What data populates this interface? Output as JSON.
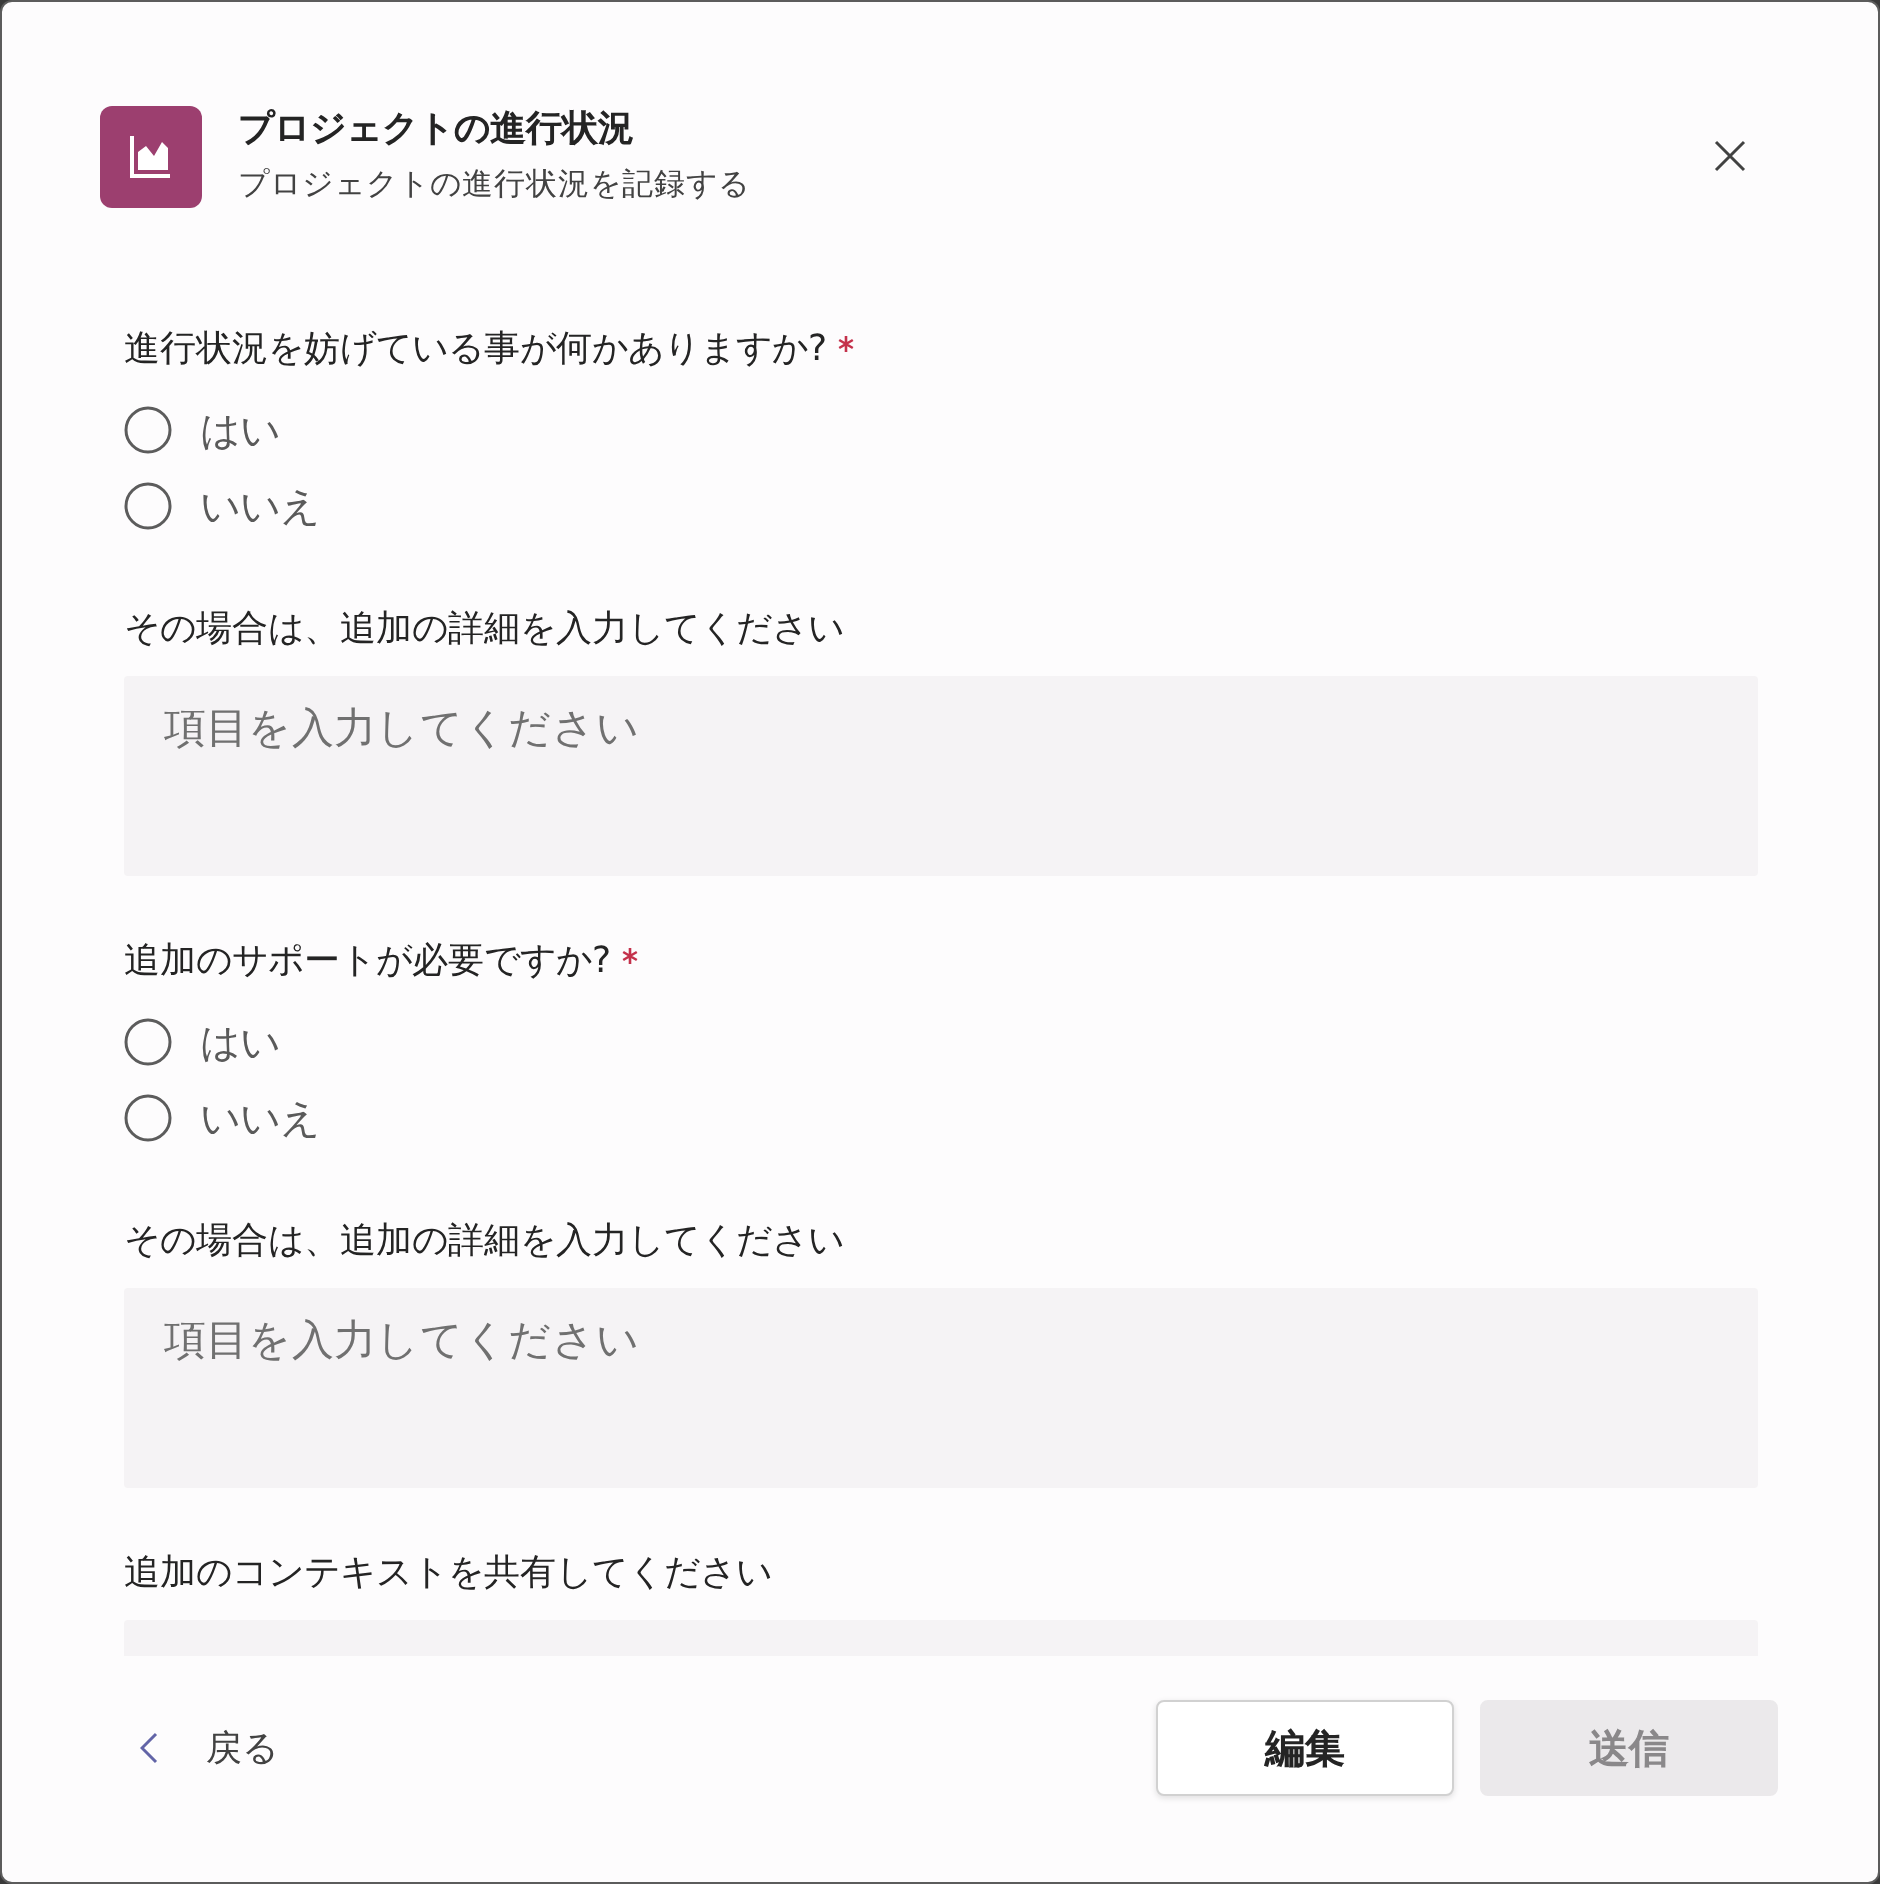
{
  "dialog": {
    "title": "プロジェクトの進行状況",
    "subtitle": "プロジェクトの進行状況を記録する"
  },
  "form": [
    {
      "kind": "radio",
      "label": "進行状況を妨げている事が何かありますか?",
      "required": true,
      "options": [
        {
          "label": "はい",
          "selected": false
        },
        {
          "label": "いいえ",
          "selected": false
        }
      ]
    },
    {
      "kind": "textarea",
      "label": "その場合は、追加の詳細を入力してください",
      "required": false,
      "placeholder": "項目を入力してください"
    },
    {
      "kind": "radio",
      "label": "追加のサポートが必要ですか?",
      "required": true,
      "options": [
        {
          "label": "はい",
          "selected": false
        },
        {
          "label": "いいえ",
          "selected": false
        }
      ]
    },
    {
      "kind": "textarea",
      "label": "その場合は、追加の詳細を入力してください",
      "required": false,
      "placeholder": "項目を入力してください"
    },
    {
      "kind": "textarea",
      "label": "追加のコンテキストを共有してください",
      "required": false
    }
  ],
  "footer": {
    "back": "戻る",
    "buttons": [
      {
        "label": "編集",
        "disabled": false
      },
      {
        "label": "送信",
        "disabled": true
      }
    ]
  }
}
